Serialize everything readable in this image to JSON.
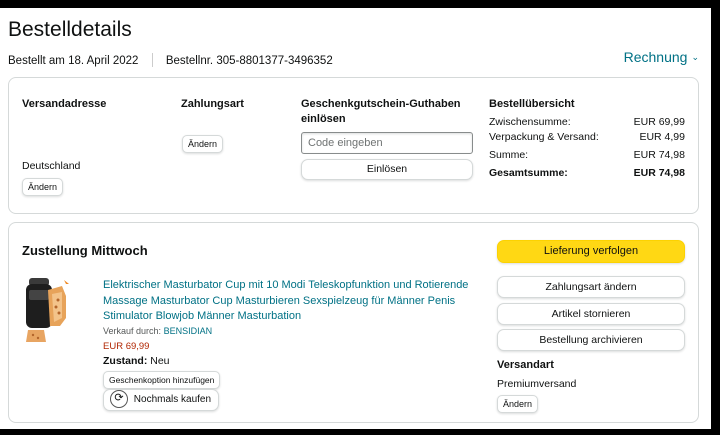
{
  "page": {
    "title": "Bestelldetails",
    "order_date": "Bestellt am 18. April 2022",
    "order_number": "Bestellnr. 305-8801377-3496352",
    "invoice_label": "Rechnung"
  },
  "shipping": {
    "heading": "Versandadresse",
    "country": "Deutschland",
    "change_label": "Ändern"
  },
  "payment": {
    "heading": "Zahlungsart",
    "change_label": "Ändern"
  },
  "gift_card": {
    "heading_line1": "Geschenkgutschein-Guthaben",
    "heading_line2": "einlösen",
    "placeholder": "Code eingeben",
    "redeem_label": "Einlösen"
  },
  "summary": {
    "heading": "Bestellübersicht",
    "rows": [
      {
        "label": "Zwischensumme:",
        "value": "EUR 69,99"
      },
      {
        "label": "Verpackung & Versand:",
        "value": "EUR 4,99"
      },
      {
        "label": "Summe:",
        "value": "EUR 74,98"
      },
      {
        "label": "Gesamtsumme:",
        "value": "EUR 74,98"
      }
    ]
  },
  "delivery": {
    "heading": "Zustellung Mittwoch",
    "product": {
      "title": "Elektrischer Masturbator Cup mit 10 Modi Teleskopfunktion und Rotierende Massage Masturbator Cup Masturbieren Sexspielzeug für Männer Penis Stimulator Blowjob Männer Masturbation",
      "sold_by_label": "Verkauf durch:",
      "seller": "BENSIDIAN",
      "price": "EUR 69,99",
      "condition_label": "Zustand:",
      "condition": "Neu",
      "gift_option_label": "Geschenkoption hinzufügen",
      "buy_again_label": "Nochmals kaufen"
    },
    "actions": {
      "track": "Lieferung verfolgen",
      "change_payment": "Zahlungsart ändern",
      "cancel": "Artikel stornieren",
      "archive": "Bestellung archivieren"
    },
    "shipping_method": {
      "heading": "Versandart",
      "value": "Premiumversand",
      "change_label": "Ändern"
    }
  },
  "colors": {
    "link": "#007185",
    "price": "#b12704",
    "primary_button": "#ffd814",
    "border": "#d5d9d9"
  }
}
